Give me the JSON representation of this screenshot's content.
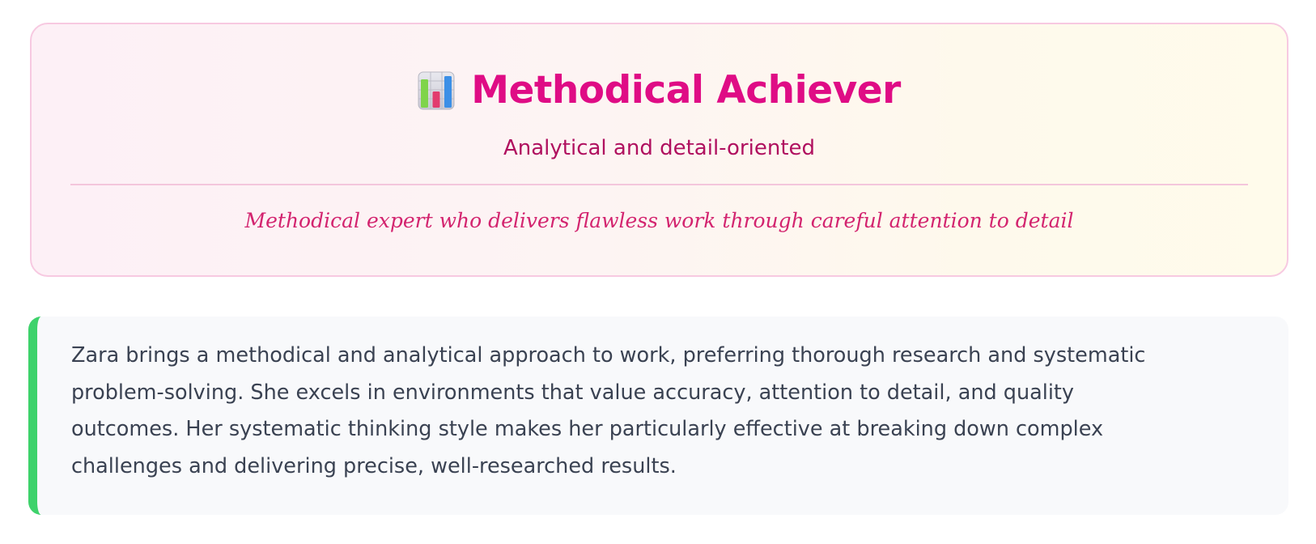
{
  "header": {
    "icon": "bar-chart-icon",
    "title": "Methodical Achiever",
    "subtitle": "Analytical and detail-oriented",
    "tagline": "Methodical expert who delivers flawless work through careful attention to detail"
  },
  "bio": {
    "text": "Zara brings a methodical and analytical approach to work, preferring thorough research and systematic problem-solving. She excels in environments that value accuracy, attention to detail, and quality outcomes. Her systematic thinking style makes her particularly effective at breaking down complex challenges and delivering precise, well-researched results."
  },
  "colors": {
    "title": "#df0c85",
    "subtitle": "#b0105f",
    "tagline": "#d3246f",
    "card_border": "#f7c9e1",
    "bio_accent": "#3ed26b",
    "bio_background": "#f8f9fb",
    "bio_text": "#3a4252"
  }
}
